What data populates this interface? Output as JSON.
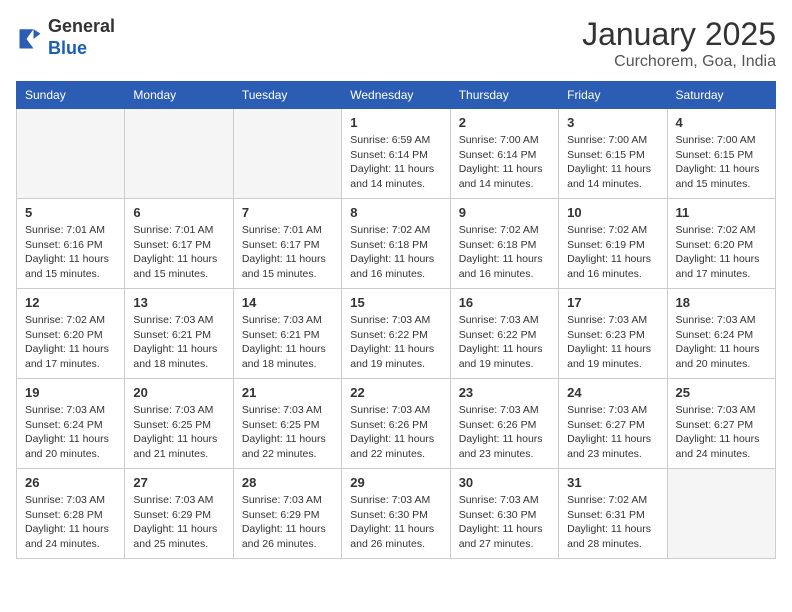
{
  "header": {
    "logo": {
      "general": "General",
      "blue": "Blue"
    },
    "title": "January 2025",
    "subtitle": "Curchorem, Goa, India"
  },
  "days_of_week": [
    "Sunday",
    "Monday",
    "Tuesday",
    "Wednesday",
    "Thursday",
    "Friday",
    "Saturday"
  ],
  "weeks": [
    [
      {
        "day": "",
        "info": ""
      },
      {
        "day": "",
        "info": ""
      },
      {
        "day": "",
        "info": ""
      },
      {
        "day": "1",
        "info": "Sunrise: 6:59 AM\nSunset: 6:14 PM\nDaylight: 11 hours and 14 minutes."
      },
      {
        "day": "2",
        "info": "Sunrise: 7:00 AM\nSunset: 6:14 PM\nDaylight: 11 hours and 14 minutes."
      },
      {
        "day": "3",
        "info": "Sunrise: 7:00 AM\nSunset: 6:15 PM\nDaylight: 11 hours and 14 minutes."
      },
      {
        "day": "4",
        "info": "Sunrise: 7:00 AM\nSunset: 6:15 PM\nDaylight: 11 hours and 15 minutes."
      }
    ],
    [
      {
        "day": "5",
        "info": "Sunrise: 7:01 AM\nSunset: 6:16 PM\nDaylight: 11 hours and 15 minutes."
      },
      {
        "day": "6",
        "info": "Sunrise: 7:01 AM\nSunset: 6:17 PM\nDaylight: 11 hours and 15 minutes."
      },
      {
        "day": "7",
        "info": "Sunrise: 7:01 AM\nSunset: 6:17 PM\nDaylight: 11 hours and 15 minutes."
      },
      {
        "day": "8",
        "info": "Sunrise: 7:02 AM\nSunset: 6:18 PM\nDaylight: 11 hours and 16 minutes."
      },
      {
        "day": "9",
        "info": "Sunrise: 7:02 AM\nSunset: 6:18 PM\nDaylight: 11 hours and 16 minutes."
      },
      {
        "day": "10",
        "info": "Sunrise: 7:02 AM\nSunset: 6:19 PM\nDaylight: 11 hours and 16 minutes."
      },
      {
        "day": "11",
        "info": "Sunrise: 7:02 AM\nSunset: 6:20 PM\nDaylight: 11 hours and 17 minutes."
      }
    ],
    [
      {
        "day": "12",
        "info": "Sunrise: 7:02 AM\nSunset: 6:20 PM\nDaylight: 11 hours and 17 minutes."
      },
      {
        "day": "13",
        "info": "Sunrise: 7:03 AM\nSunset: 6:21 PM\nDaylight: 11 hours and 18 minutes."
      },
      {
        "day": "14",
        "info": "Sunrise: 7:03 AM\nSunset: 6:21 PM\nDaylight: 11 hours and 18 minutes."
      },
      {
        "day": "15",
        "info": "Sunrise: 7:03 AM\nSunset: 6:22 PM\nDaylight: 11 hours and 19 minutes."
      },
      {
        "day": "16",
        "info": "Sunrise: 7:03 AM\nSunset: 6:22 PM\nDaylight: 11 hours and 19 minutes."
      },
      {
        "day": "17",
        "info": "Sunrise: 7:03 AM\nSunset: 6:23 PM\nDaylight: 11 hours and 19 minutes."
      },
      {
        "day": "18",
        "info": "Sunrise: 7:03 AM\nSunset: 6:24 PM\nDaylight: 11 hours and 20 minutes."
      }
    ],
    [
      {
        "day": "19",
        "info": "Sunrise: 7:03 AM\nSunset: 6:24 PM\nDaylight: 11 hours and 20 minutes."
      },
      {
        "day": "20",
        "info": "Sunrise: 7:03 AM\nSunset: 6:25 PM\nDaylight: 11 hours and 21 minutes."
      },
      {
        "day": "21",
        "info": "Sunrise: 7:03 AM\nSunset: 6:25 PM\nDaylight: 11 hours and 22 minutes."
      },
      {
        "day": "22",
        "info": "Sunrise: 7:03 AM\nSunset: 6:26 PM\nDaylight: 11 hours and 22 minutes."
      },
      {
        "day": "23",
        "info": "Sunrise: 7:03 AM\nSunset: 6:26 PM\nDaylight: 11 hours and 23 minutes."
      },
      {
        "day": "24",
        "info": "Sunrise: 7:03 AM\nSunset: 6:27 PM\nDaylight: 11 hours and 23 minutes."
      },
      {
        "day": "25",
        "info": "Sunrise: 7:03 AM\nSunset: 6:27 PM\nDaylight: 11 hours and 24 minutes."
      }
    ],
    [
      {
        "day": "26",
        "info": "Sunrise: 7:03 AM\nSunset: 6:28 PM\nDaylight: 11 hours and 24 minutes."
      },
      {
        "day": "27",
        "info": "Sunrise: 7:03 AM\nSunset: 6:29 PM\nDaylight: 11 hours and 25 minutes."
      },
      {
        "day": "28",
        "info": "Sunrise: 7:03 AM\nSunset: 6:29 PM\nDaylight: 11 hours and 26 minutes."
      },
      {
        "day": "29",
        "info": "Sunrise: 7:03 AM\nSunset: 6:30 PM\nDaylight: 11 hours and 26 minutes."
      },
      {
        "day": "30",
        "info": "Sunrise: 7:03 AM\nSunset: 6:30 PM\nDaylight: 11 hours and 27 minutes."
      },
      {
        "day": "31",
        "info": "Sunrise: 7:02 AM\nSunset: 6:31 PM\nDaylight: 11 hours and 28 minutes."
      },
      {
        "day": "",
        "info": ""
      }
    ]
  ]
}
